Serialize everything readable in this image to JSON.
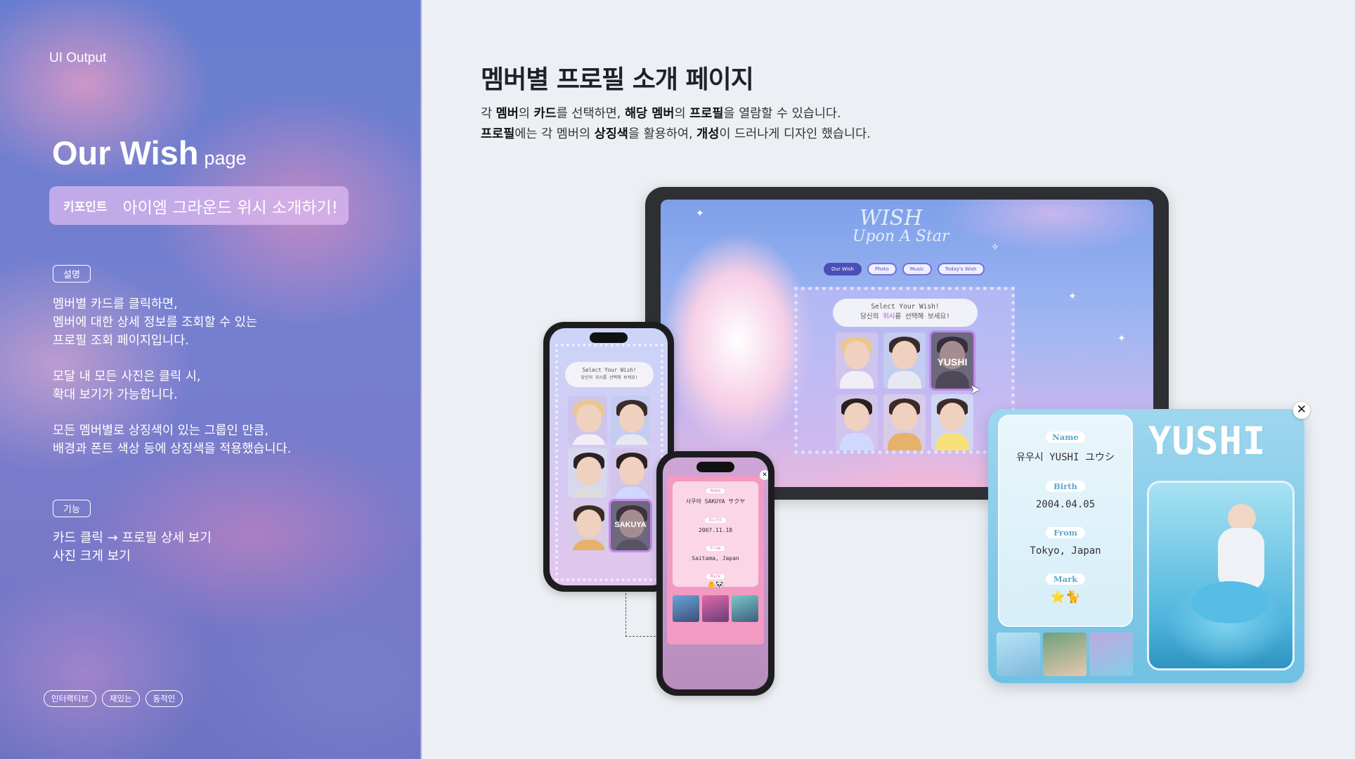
{
  "left": {
    "section_label": "UI Output",
    "title_main": "Our Wish",
    "title_sub": "page",
    "keypoint_label": "키포인트",
    "keypoint_text": "아이엠 그라운드 위시 소개하기!",
    "desc_tag": "설명",
    "desc_lines": [
      "멤버별 카드를 클릭하면,",
      "멤버에 대한 상세 정보를 조회할 수 있는",
      "프로필 조회 페이지입니다.",
      "모달 내 모든 사진은 클릭 시,",
      "확대 보기가 가능합니다.",
      "모든 멤버별로 상징색이 있는 그룹인 만큼,",
      "배경과 폰트 색상 등에 상징색을 적용했습니다."
    ],
    "func_tag": "기능",
    "func_lines": [
      "카드 클릭 → 프로필 상세 보기",
      "사진 크게 보기"
    ],
    "keywords": [
      "인터랙티브",
      "재밌는",
      "동적인"
    ]
  },
  "right": {
    "heading": "멤버별 프로필 소개 페이지",
    "intro_line1": [
      {
        "t": " 각 "
      },
      {
        "t": "멤버",
        "b": true
      },
      {
        "t": "의 "
      },
      {
        "t": "카드",
        "b": true
      },
      {
        "t": "를 선택하면, "
      },
      {
        "t": "해당 멤버",
        "b": true
      },
      {
        "t": "의 "
      },
      {
        "t": "프로필",
        "b": true
      },
      {
        "t": "을 열람할 수 있습니다."
      }
    ],
    "intro_line2": [
      {
        "t": "프로필",
        "b": true
      },
      {
        "t": "에는 각 멤버의 "
      },
      {
        "t": "상징색",
        "b": true
      },
      {
        "t": "을 활용하여, "
      },
      {
        "t": "개성",
        "b": true
      },
      {
        "t": "이 드러나게 디자인 했습니다."
      }
    ]
  },
  "tablet": {
    "logo_line1": "WISH",
    "logo_line2": "Upon A Star",
    "nav": [
      "Our Wish",
      "Photo",
      "Music",
      "Today's Wish"
    ],
    "active_nav": "Our Wish",
    "bubble_en": "Select Your Wish!",
    "bubble_ko_a": "당신의 ",
    "bubble_ko_b": "위시",
    "bubble_ko_c": "를 선택해 보세요!",
    "selected_card_label": "YUSHI"
  },
  "phone1": {
    "bubble_en": "Select Your Wish!",
    "bubble_ko": "당신의 위시를 선택해 보세요!",
    "selected_card_label": "SAKUYA"
  },
  "phone2": {
    "name_label": "Name",
    "name_value": "사쿠야 SAKUYA サクヤ",
    "birth_label": "Birth",
    "birth_value": "2007.11.18",
    "from_label": "From",
    "from_value": "Saitama, Japan",
    "mark_label": "Mark",
    "mark_value": "🐥🐼"
  },
  "modal": {
    "close_symbol": "✕",
    "big_name": "YUSHI",
    "name_label": "Name",
    "name_value": "유우시 YUSHI ユウシ",
    "birth_label": "Birth",
    "birth_value": "2004.04.05",
    "from_label": "From",
    "from_value": "Tokyo, Japan",
    "mark_label": "Mark",
    "mark_value": "⭐🐈"
  },
  "colors": {
    "accent_purple": "#4b4fb7",
    "yushi_blue": "#6fc1e3",
    "sakuya_pink": "#f39ac3",
    "page_bg": "#eceff3"
  }
}
